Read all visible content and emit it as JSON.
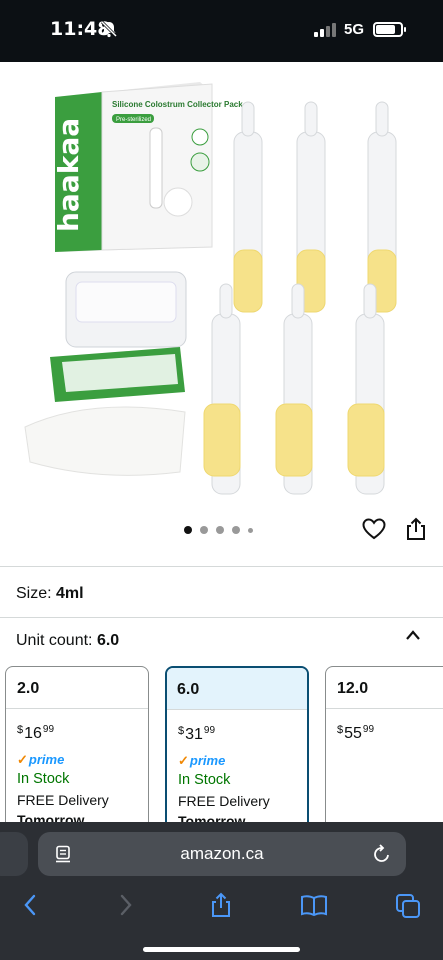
{
  "status_bar": {
    "time": "11:48",
    "network": "5G"
  },
  "product_image": {
    "brand": "haakaa",
    "box_title": "Silicone Colostrum Collector Pack",
    "box_sub": "Pre-sterilized",
    "prev_line": "Colostrum Collector Pack"
  },
  "carousel": {
    "count": 5,
    "active": 0
  },
  "size": {
    "label": "Size:",
    "value": "4ml"
  },
  "unit_count": {
    "label": "Unit count:",
    "value": "6.0"
  },
  "options": [
    {
      "title": "2.0",
      "currency": "$",
      "dollars": "16",
      "cents": "99",
      "prime": "prime",
      "stock": "In Stock",
      "delivery": "FREE Delivery",
      "when": "Tomorrow"
    },
    {
      "title": "6.0",
      "currency": "$",
      "dollars": "31",
      "cents": "99",
      "prime": "prime",
      "stock": "In Stock",
      "delivery": "FREE Delivery",
      "when": "Tomorrow"
    },
    {
      "title": "12.0",
      "currency": "$",
      "dollars": "55",
      "cents": "99"
    }
  ],
  "browser": {
    "url": "amazon.ca"
  },
  "colors": {
    "selected_border": "#0a4e72",
    "selected_bg": "#e3f3fc",
    "in_stock": "#007600",
    "prime_blue": "#1a98ff",
    "toolbar": "#2c2f34"
  }
}
